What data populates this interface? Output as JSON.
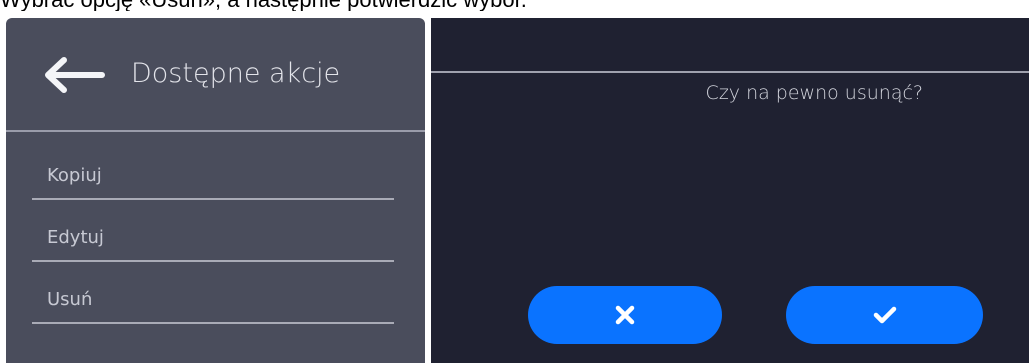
{
  "caption": {
    "text": "Wybrać opcję «Usuń», a następnie potwierdzić wybór."
  },
  "actions_panel": {
    "title": "Dostępne akcje",
    "back_icon": "arrow-left-icon",
    "items": [
      {
        "label": "Kopiuj"
      },
      {
        "label": "Edytuj"
      },
      {
        "label": "Usuń"
      }
    ]
  },
  "confirm_dialog": {
    "question": "Czy na pewno usunąć?",
    "cancel_icon": "close-icon",
    "confirm_icon": "checkmark-icon"
  },
  "colors": {
    "left_panel_bg": "#4a4d5c",
    "right_panel_bg": "#1f2131",
    "button_blue": "#0a73ff",
    "text_light": "#e3e4ea"
  }
}
